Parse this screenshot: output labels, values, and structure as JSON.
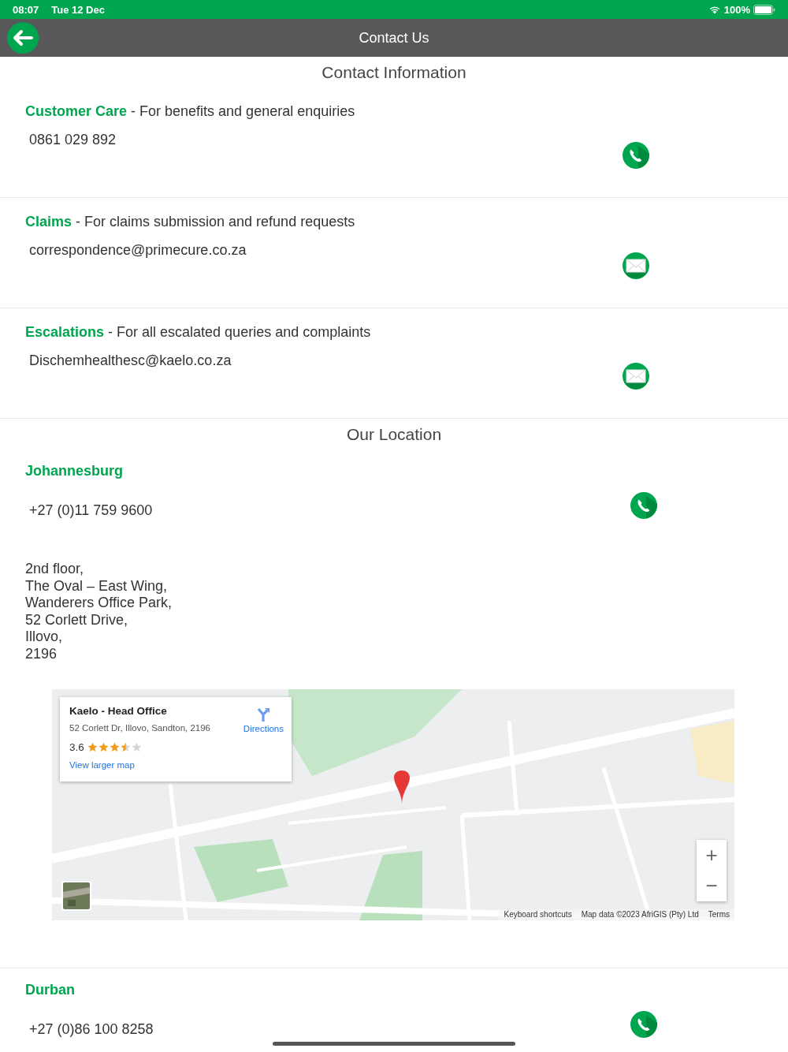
{
  "status_bar": {
    "time": "08:07",
    "date": "Tue 12 Dec",
    "battery": "100%"
  },
  "header": {
    "title": "Contact Us"
  },
  "contact_title": "Contact Information",
  "contacts": [
    {
      "name": "Customer Care",
      "description": " - For benefits and general enquiries",
      "value": "0861 029 892",
      "kind": "phone"
    },
    {
      "name": "Claims",
      "description": " - For claims submission and refund requests",
      "value": "correspondence@primecure.co.za",
      "kind": "email"
    },
    {
      "name": "Escalations",
      "description": " - For all escalated queries and complaints",
      "value": "Dischemhealthesc@kaelo.co.za",
      "kind": "email"
    }
  ],
  "location_title": "Our Location",
  "locations": [
    {
      "name": "Johannesburg",
      "phone": "+27 (0)11 759 9600",
      "address": [
        "2nd floor,",
        "The Oval – East Wing,",
        "Wanderers Office Park,",
        "52 Corlett Drive,",
        "Illovo,",
        "2196"
      ],
      "map": {
        "place": "Kaelo - Head Office",
        "place_address": "52 Corlett Dr, Illovo, Sandton, 2196",
        "rating": "3.6",
        "stars": 3.5,
        "directions": "Directions",
        "larger_map": "View larger map",
        "zoom_in": "+",
        "zoom_out": "−",
        "shortcuts": "Keyboard shortcuts",
        "map_data": "Map data ©2023 AfriGIS (Pty) Ltd",
        "terms": "Terms"
      }
    },
    {
      "name": "Durban",
      "phone": "+27 (0)86 100 8258"
    }
  ]
}
